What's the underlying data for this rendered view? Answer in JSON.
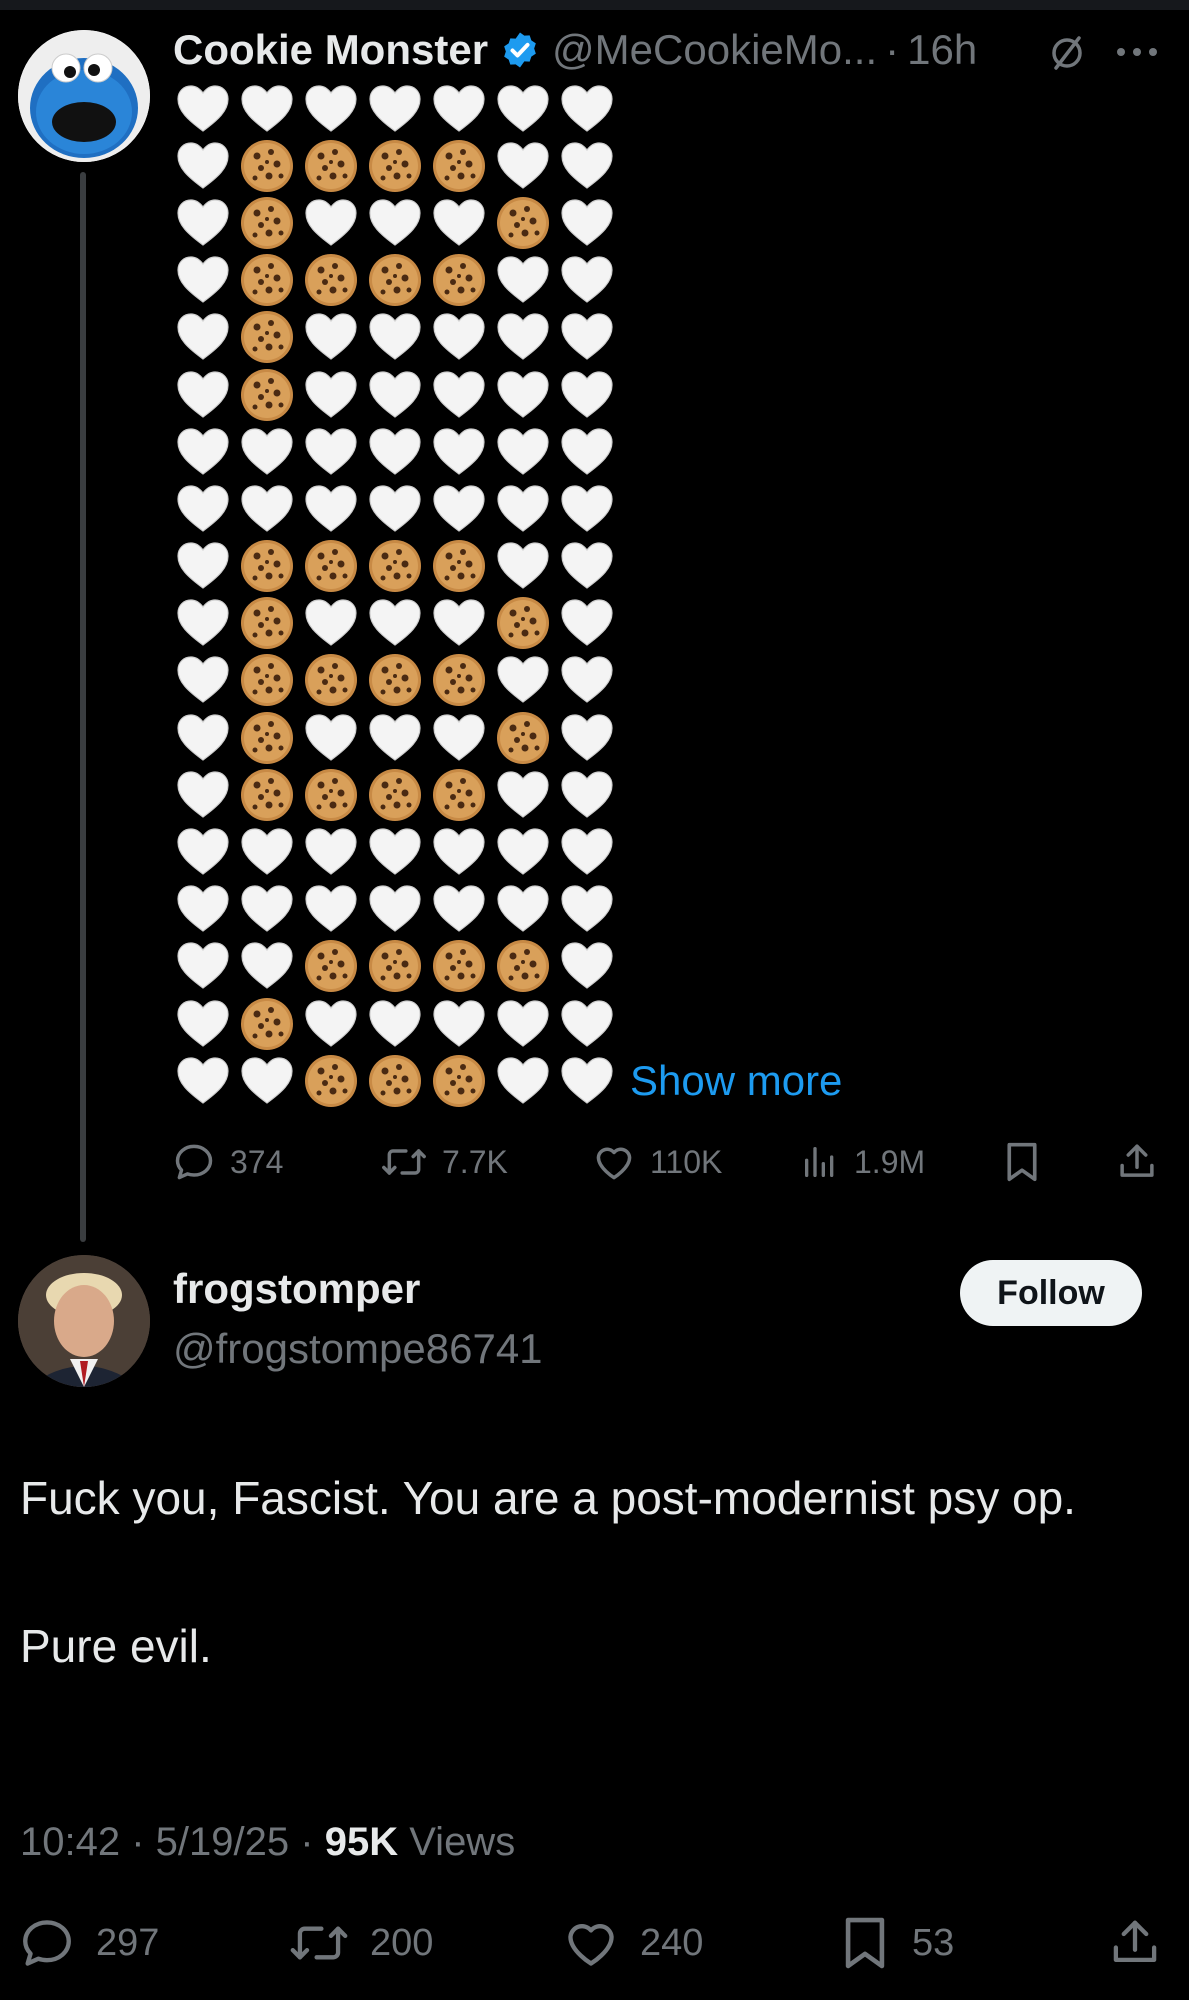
{
  "original_post": {
    "display_name": "Cookie Monster",
    "handle": "@MeCookieMo...",
    "time": "16h",
    "separator": "·",
    "show_more": "Show more",
    "emoji_rows": [
      "HHHHHHH",
      "HCCCCHH",
      "HCHHHCH",
      "HCCCCHH",
      "HCHHHHH",
      "HCHHHHH",
      "HHHHHHH",
      "HHHHHHH",
      "HCCCCHH",
      "HCHHHCH",
      "HCCCCHH",
      "HCHHHCH",
      "HCCCCHH",
      "HHHHHHH",
      "HHHHHHH",
      "HHCCCCH",
      "HCHHHHH",
      "HHCCCHH"
    ],
    "emoji_legend": {
      "H": "white-heart",
      "C": "cookie"
    },
    "stats": {
      "replies": "374",
      "reposts": "7.7K",
      "likes": "110K",
      "views": "1.9M"
    }
  },
  "reply": {
    "display_name": "frogstomper",
    "handle": "@frogstompe86741",
    "follow_label": "Follow",
    "text_line1": "Fuck you, Fascist. You are a post-modernist psy op.",
    "text_line2": "Pure evil.",
    "time": "10:42",
    "date": "5/19/25",
    "views_count": "95K",
    "views_label": "Views",
    "stats": {
      "replies": "297",
      "reposts": "200",
      "likes": "240",
      "bookmarks": "53"
    }
  },
  "colors": {
    "background": "#000000",
    "text_primary": "#e7e9ea",
    "text_secondary": "#71767b",
    "accent": "#1d9bf0",
    "follow_bg": "#eff3f4"
  },
  "icons": [
    "verified-badge-icon",
    "mute-icon",
    "more-icon",
    "reply-icon",
    "repost-icon",
    "like-icon",
    "views-icon",
    "bookmark-icon",
    "share-icon"
  ]
}
